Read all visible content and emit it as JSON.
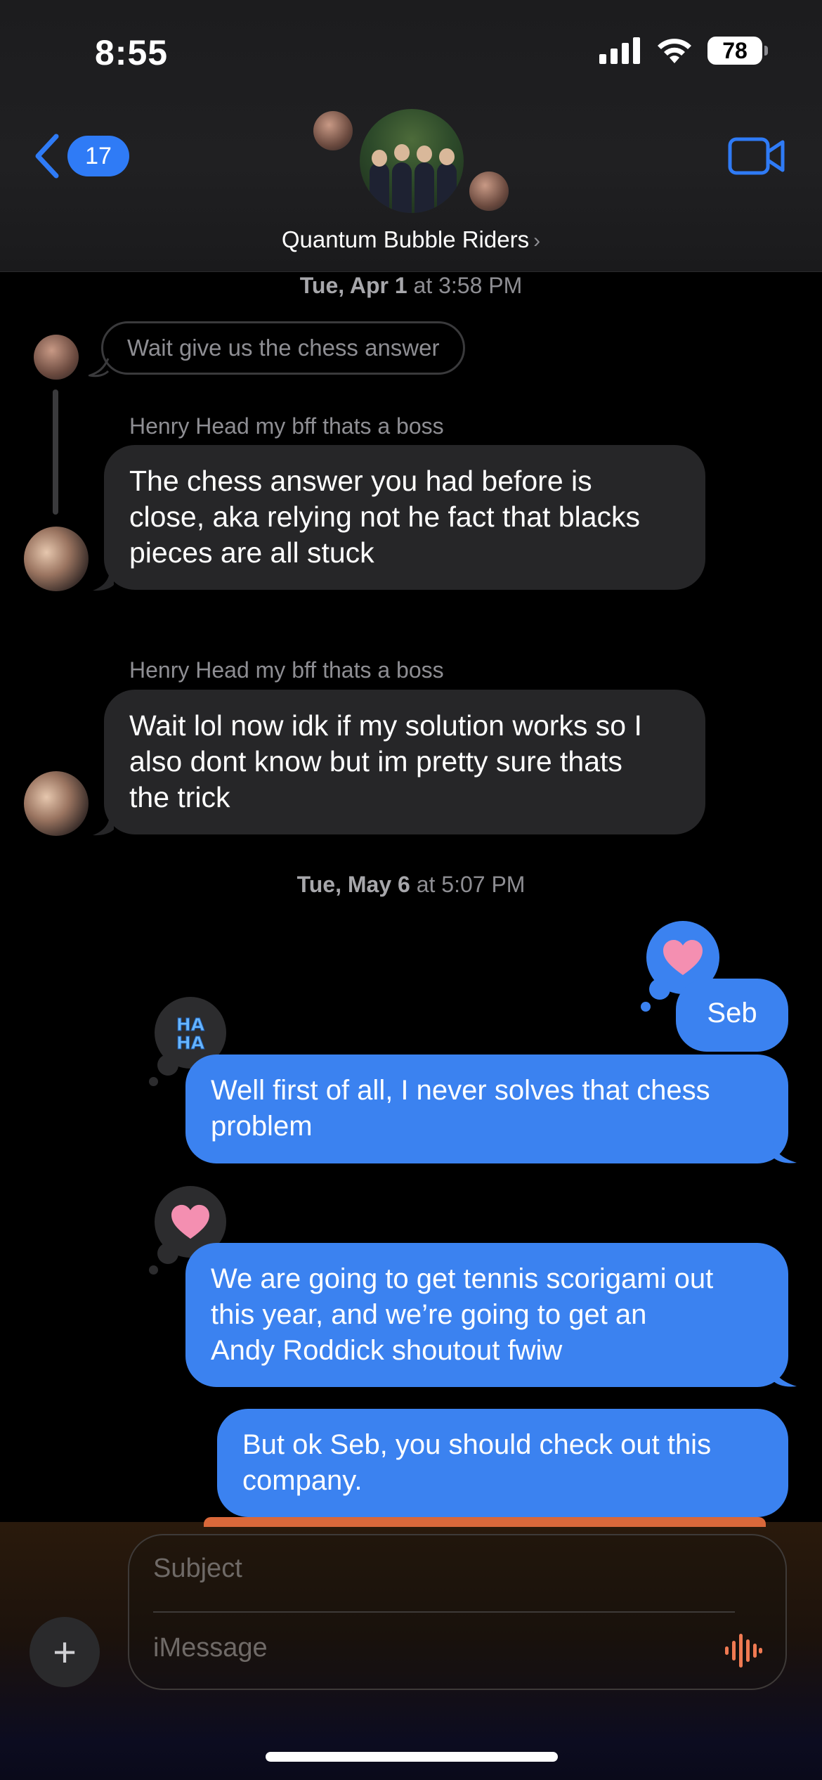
{
  "status_bar": {
    "time": "8:55",
    "battery": "78"
  },
  "header": {
    "back_count": "17",
    "group_name": "Quantum Bubble Riders",
    "chevron": "›"
  },
  "timestamps": [
    {
      "day": "Tue, Apr 1",
      "rest": " at 3:58 PM"
    },
    {
      "day": "Tue, May 6",
      "rest": " at 5:07 PM"
    }
  ],
  "messages": {
    "reply_context": "Wait give us the chess answer",
    "incoming": [
      {
        "sender": "Henry Head my bff thats a boss",
        "lines": [
          "The chess answer you had before is",
          "close, aka relying not he fact that blacks",
          "pieces are all stuck"
        ]
      },
      {
        "sender": "Henry Head my bff thats a boss",
        "lines": [
          "Wait lol now idk if my solution works so I",
          "also dont know but im pretty sure thats",
          "the trick"
        ]
      }
    ],
    "outgoing": [
      {
        "lines": [
          "Seb"
        ],
        "tapback": "heart"
      },
      {
        "lines": [
          "Well first of all, I never solves that chess",
          "problem"
        ],
        "tapback": "haha"
      },
      {
        "lines": [
          "We are going to get tennis scorigami out",
          "this year, and we’re going to get an",
          "Andy Roddick shoutout fwiw"
        ],
        "tapback": "heart"
      },
      {
        "lines": [
          "But ok Seb, you should check out this",
          "company."
        ]
      }
    ]
  },
  "compose": {
    "subject_placeholder": "Subject",
    "message_placeholder": "iMessage",
    "plus": "+"
  },
  "colors": {
    "bubble_out": "#3b82f0",
    "bubble_in": "#262628",
    "accent": "#2f7bf6",
    "heart": "#f48fb1"
  }
}
